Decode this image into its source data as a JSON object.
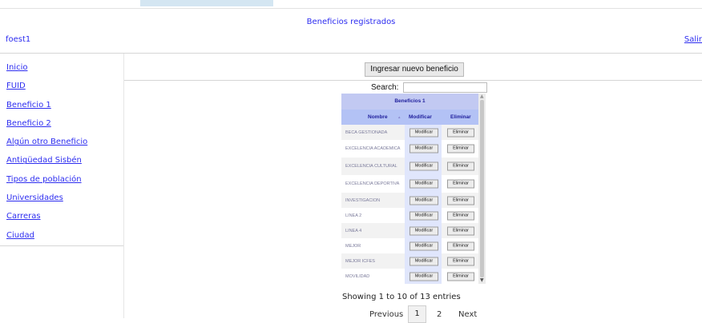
{
  "header": {
    "title": "Beneficios registrados",
    "user": "foest1",
    "logout": "Salir"
  },
  "sidebar": {
    "items": [
      {
        "label": "Inicio"
      },
      {
        "label": "FUID"
      },
      {
        "label": "Beneficio 1"
      },
      {
        "label": "Beneficio 2"
      },
      {
        "label": "Algún otro Beneficio"
      },
      {
        "label": "Antigüedad Sisbén"
      },
      {
        "label": "Tipos de población"
      },
      {
        "label": "Universidades"
      },
      {
        "label": "Carreras"
      },
      {
        "label": "Ciudad"
      }
    ]
  },
  "actions": {
    "new_benefit": "Ingresar nuevo beneficio"
  },
  "search": {
    "label": "Search:",
    "value": ""
  },
  "table": {
    "caption": "Beneficios 1",
    "columns": [
      "Nombre",
      "Modificar",
      "Eliminar"
    ],
    "sort_indicator": "▲",
    "modify_label": "Modificar",
    "delete_label": "Eliminar",
    "rows": [
      {
        "name": "BECA GESTIONADA"
      },
      {
        "name": "EXCELENCIA ACADEMICA"
      },
      {
        "name": "EXCELENCIA CULTURAL"
      },
      {
        "name": "EXCELENCIA DEPORTIVA"
      },
      {
        "name": "INVESTIGACION"
      },
      {
        "name": "LINEA 2"
      },
      {
        "name": "LINEA 4"
      },
      {
        "name": "MEJOR"
      },
      {
        "name": "MEJOR ICFES"
      },
      {
        "name": "MOVILIDAD"
      }
    ]
  },
  "pagination": {
    "info": "Showing 1 to 10 of 13 entries",
    "previous": "Previous",
    "pages": [
      "1",
      "2"
    ],
    "next": "Next"
  },
  "colors": {
    "link": "#2d2df0",
    "table_header": "#b3c2f5",
    "row_light": "#f2f2f2",
    "row_white": "#ffffff",
    "row_blue": "#e0e6fc"
  }
}
